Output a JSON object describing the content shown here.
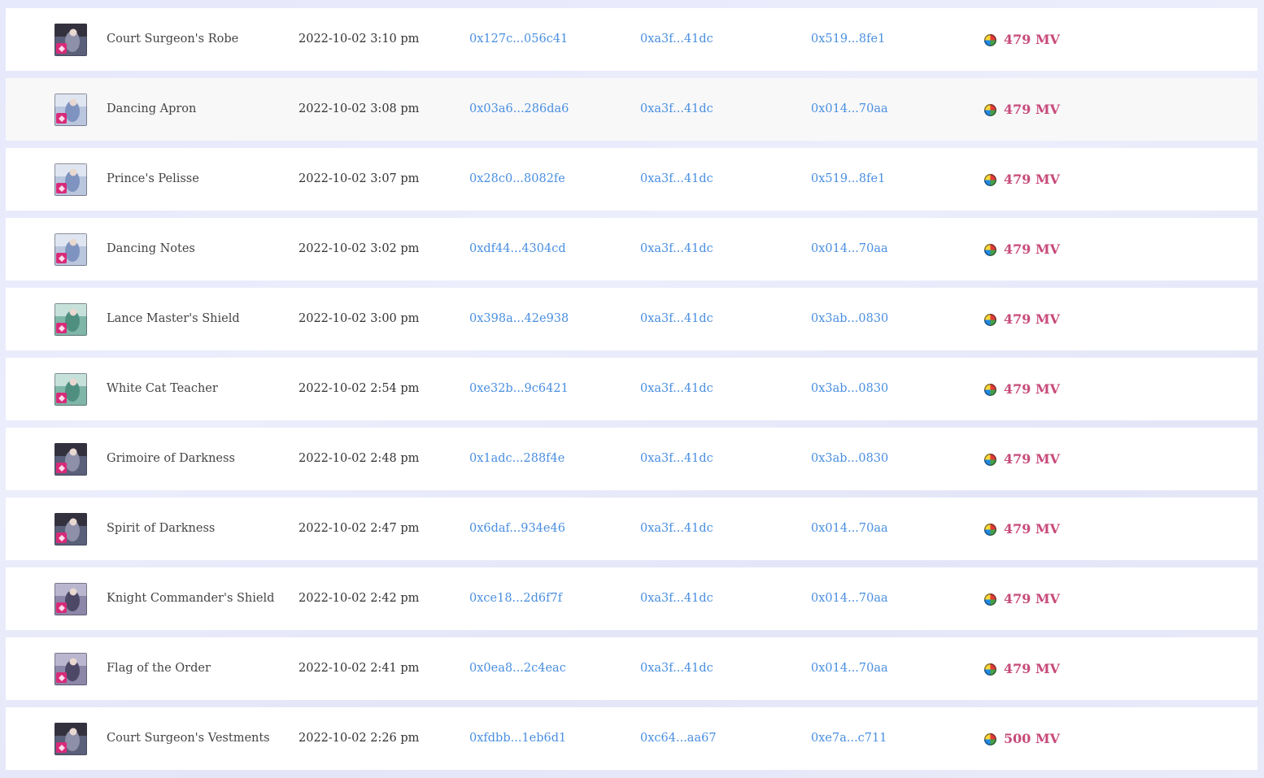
{
  "theme": {
    "accent_link": "#4a8fe0",
    "price_color": "#c74a7a"
  },
  "rows": [
    {
      "name": "Court Surgeon's Robe",
      "time": "2022-10-02 3:10 pm",
      "tx": "0x127c...056c41",
      "from": "0xa3f...41dc",
      "to": "0x519...8fe1",
      "price": "479 MV",
      "thumb": "dark",
      "currency_icon": "mv-coin-icon"
    },
    {
      "name": "Dancing Apron",
      "time": "2022-10-02 3:08 pm",
      "tx": "0x03a6...286da6",
      "from": "0xa3f...41dc",
      "to": "0x014...70aa",
      "price": "479 MV",
      "thumb": "light",
      "currency_icon": "mv-coin-icon"
    },
    {
      "name": "Prince's Pelisse",
      "time": "2022-10-02 3:07 pm",
      "tx": "0x28c0...8082fe",
      "from": "0xa3f...41dc",
      "to": "0x519...8fe1",
      "price": "479 MV",
      "thumb": "light",
      "currency_icon": "mv-coin-icon"
    },
    {
      "name": "Dancing Notes",
      "time": "2022-10-02 3:02 pm",
      "tx": "0xdf44...4304cd",
      "from": "0xa3f...41dc",
      "to": "0x014...70aa",
      "price": "479 MV",
      "thumb": "light",
      "currency_icon": "mv-coin-icon"
    },
    {
      "name": "Lance Master's Shield",
      "time": "2022-10-02 3:00 pm",
      "tx": "0x398a...42e938",
      "from": "0xa3f...41dc",
      "to": "0x3ab...0830",
      "price": "479 MV",
      "thumb": "teal",
      "currency_icon": "mv-coin-icon"
    },
    {
      "name": "White Cat Teacher",
      "time": "2022-10-02 2:54 pm",
      "tx": "0xe32b...9c6421",
      "from": "0xa3f...41dc",
      "to": "0x3ab...0830",
      "price": "479 MV",
      "thumb": "teal",
      "currency_icon": "mv-coin-icon"
    },
    {
      "name": "Grimoire of Darkness",
      "time": "2022-10-02 2:48 pm",
      "tx": "0x1adc...288f4e",
      "from": "0xa3f...41dc",
      "to": "0x3ab...0830",
      "price": "479 MV",
      "thumb": "dark",
      "currency_icon": "mv-coin-icon"
    },
    {
      "name": "Spirit of Darkness",
      "time": "2022-10-02 2:47 pm",
      "tx": "0x6daf...934e46",
      "from": "0xa3f...41dc",
      "to": "0x014...70aa",
      "price": "479 MV",
      "thumb": "dark",
      "currency_icon": "mv-coin-icon"
    },
    {
      "name": "Knight Commander's Shield",
      "time": "2022-10-02 2:42 pm",
      "tx": "0xce18...2d6f7f",
      "from": "0xa3f...41dc",
      "to": "0x014...70aa",
      "price": "479 MV",
      "thumb": "mixed",
      "currency_icon": "mv-coin-icon"
    },
    {
      "name": "Flag of the Order",
      "time": "2022-10-02 2:41 pm",
      "tx": "0x0ea8...2c4eac",
      "from": "0xa3f...41dc",
      "to": "0x014...70aa",
      "price": "479 MV",
      "thumb": "mixed",
      "currency_icon": "mv-coin-icon"
    },
    {
      "name": "Court Surgeon's Vestments",
      "time": "2022-10-02 2:26 pm",
      "tx": "0xfdbb...1eb6d1",
      "from": "0xc64...aa67",
      "to": "0xe7a...c711",
      "price": "500 MV",
      "thumb": "dark",
      "currency_icon": "mv-coin-icon"
    }
  ]
}
